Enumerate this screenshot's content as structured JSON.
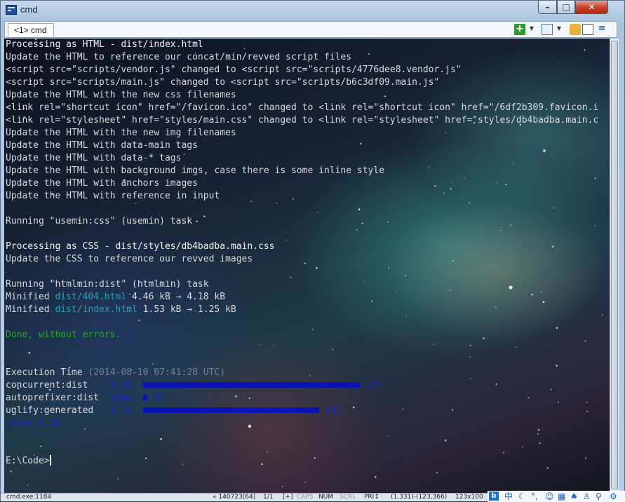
{
  "window": {
    "title": "cmd",
    "minimize_glyph": "–",
    "maximize_glyph": "□",
    "close_glyph": "✕"
  },
  "tabbar": {
    "active_tab": "<1> cmd",
    "add_glyph": "+",
    "dropdown_glyph": "▼",
    "menu_glyph": "≡"
  },
  "console": {
    "lines": [
      [
        {
          "t": "Processing as HTML - dist/index.html",
          "c": "w"
        }
      ],
      [
        {
          "t": "Update the HTML to reference our concat/min/revved script files"
        }
      ],
      [
        {
          "t": "<script src=\"scripts/vendor.js\" changed to <script src=\"scripts/4776dee8.vendor.js\""
        }
      ],
      [
        {
          "t": "<script src=\"scripts/main.js\" changed to <script src=\"scripts/b6c3df09.main.js\""
        }
      ],
      [
        {
          "t": "Update the HTML with the new css filenames"
        }
      ],
      [
        {
          "t": "<link rel=\"shortcut icon\" href=\"/favicon.ico\" changed to <link rel=\"shortcut icon\" href=\"/6df2b309.favicon.i"
        }
      ],
      [
        {
          "t": "<link rel=\"stylesheet\" href=\"styles/main.css\" changed to <link rel=\"stylesheet\" href=\"styles/db4badba.main.c"
        }
      ],
      [
        {
          "t": "Update the HTML with the new img filenames"
        }
      ],
      [
        {
          "t": "Update the HTML with data-main tags"
        }
      ],
      [
        {
          "t": "Update the HTML with data-* tags"
        }
      ],
      [
        {
          "t": "Update the HTML with background imgs, case there is some inline style"
        }
      ],
      [
        {
          "t": "Update the HTML with anchors images"
        }
      ],
      [
        {
          "t": "Update the HTML with reference in input"
        }
      ],
      [],
      [
        {
          "t": "Running \"usemin:css\" (usemin) task"
        }
      ],
      [],
      [
        {
          "t": "Processing as CSS - dist/styles/db4badba.main.css",
          "c": "w"
        }
      ],
      [
        {
          "t": "Update the CSS to reference our revved images"
        }
      ],
      [],
      [
        {
          "t": "Running \"htmlmin:dist\" (htmlmin) task"
        }
      ],
      [
        {
          "t": "Minified "
        },
        {
          "t": "dist/404.html",
          "c": "c"
        },
        {
          "t": " 4.46 kB → 4.18 kB"
        }
      ],
      [
        {
          "t": "Minified "
        },
        {
          "t": "dist/index.html",
          "c": "c"
        },
        {
          "t": " 1.53 kB → 1.25 kB"
        }
      ],
      [],
      [
        {
          "t": "Done, without errors.",
          "c": "g"
        }
      ],
      [],
      [],
      [
        {
          "t": "Execution Time"
        },
        {
          "t": " (2014-08-10 07:41:28 UTC)",
          "c": "gr"
        }
      ],
      [
        {
          "t": "concurrent:dist    "
        },
        {
          "t": "3.3s",
          "c": "b"
        },
        {
          "t": "  "
        },
        {
          "bar": 53
        },
        {
          "t": " 53%",
          "c": "b"
        }
      ],
      [
        {
          "t": "autoprefixer:dist  "
        },
        {
          "t": "59ms",
          "c": "b"
        },
        {
          "t": "  "
        },
        {
          "bar": 1
        },
        {
          "t": " 1%",
          "c": "b"
        }
      ],
      [
        {
          "t": "uglify:generated   "
        },
        {
          "t": "2.7s",
          "c": "b"
        },
        {
          "t": "  "
        },
        {
          "bar": 43
        },
        {
          "t": " 43%",
          "c": "b"
        }
      ],
      [
        {
          "t": "Total 6.2s",
          "c": "b"
        }
      ],
      [],
      [],
      [
        {
          "t": "E:\\Code>"
        },
        {
          "cursor": true
        }
      ]
    ]
  },
  "statusbar": {
    "process": "cmd.exe:1184",
    "buffer": "« 140723[64]",
    "console_index": "1/1",
    "insert": "[+]",
    "caps": "CAPS",
    "num": "NUM",
    "scrl": "SCRL",
    "pri": "PRI↕",
    "selection": "(1,331)-(123,366)",
    "size": "123x100",
    "ime_lang": "中"
  },
  "colors": {
    "done_green": "#28a528",
    "file_cyan": "#2aa1b3",
    "timing_blue": "#1b23c8",
    "bar_blue": "#0a14b4"
  }
}
